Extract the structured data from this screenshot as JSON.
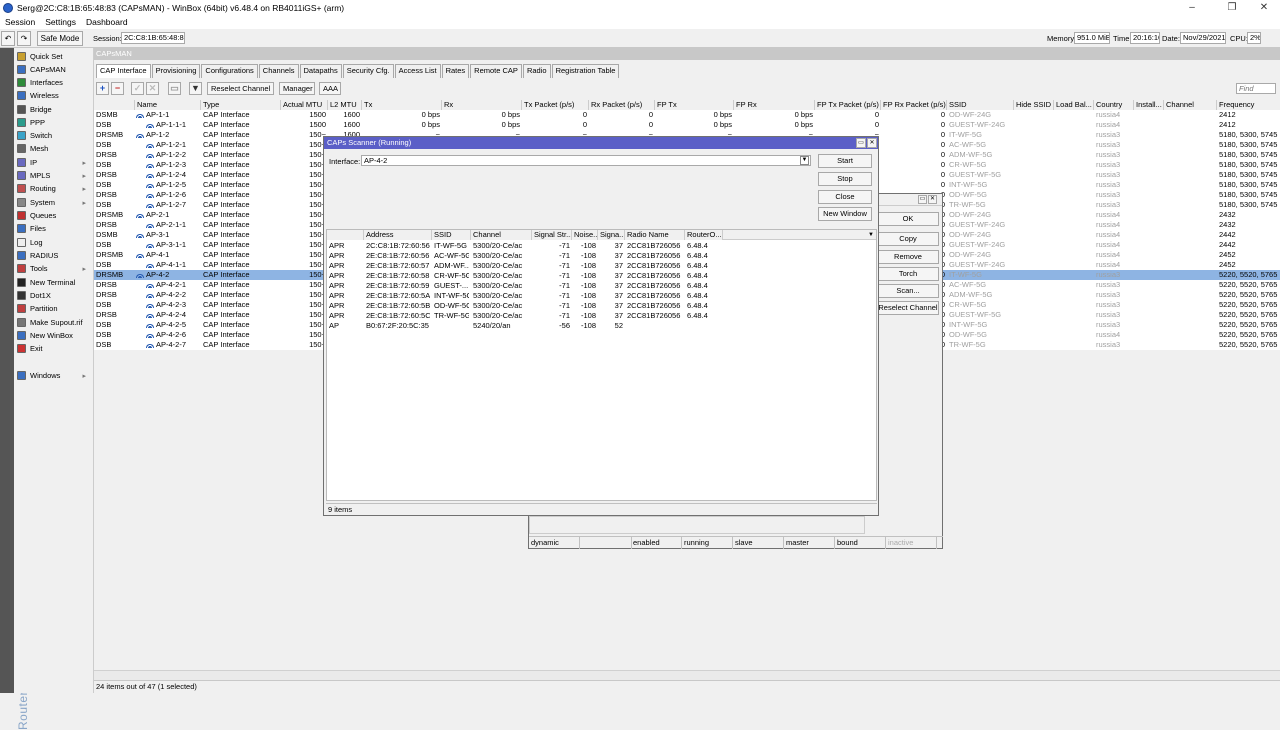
{
  "window": {
    "title": "Serg@2C:C8:1B:65:48:83 (CAPsMAN) - WinBox (64bit) v6.48.4 on RB4011iGS+ (arm)",
    "minimize": "–",
    "maximize": "❐",
    "close": "✕"
  },
  "menubar": [
    "Session",
    "Settings",
    "Dashboard"
  ],
  "toolbar": {
    "undo": "↶",
    "redo": "↷",
    "safe_mode": "Safe Mode",
    "session_label": "Session:",
    "session_value": "2C:C8:1B:65:48:83",
    "memory_label": "Memory:",
    "memory_value": "951.0 MiB",
    "time_label": "Time:",
    "time_value": "20:16:16",
    "date_label": "Date:",
    "date_value": "Nov/29/2021",
    "cpu_label": "CPU:",
    "cpu_value": "2%"
  },
  "sidebar": {
    "brand": "RouterOS WinBox",
    "items": [
      {
        "label": "Quick Set",
        "icon": "quick-set-icon",
        "color": "#c8a030"
      },
      {
        "label": "CAPsMAN",
        "icon": "capsman-icon",
        "color": "#3b6fc0"
      },
      {
        "label": "Interfaces",
        "icon": "interfaces-icon",
        "color": "#2e8b3a"
      },
      {
        "label": "Wireless",
        "icon": "wireless-icon",
        "color": "#3b6fc0"
      },
      {
        "label": "Bridge",
        "icon": "bridge-icon",
        "color": "#555555"
      },
      {
        "label": "PPP",
        "icon": "ppp-icon",
        "color": "#2b9c8c"
      },
      {
        "label": "Switch",
        "icon": "switch-icon",
        "color": "#3aa3c9"
      },
      {
        "label": "Mesh",
        "icon": "mesh-icon",
        "color": "#666666"
      },
      {
        "label": "IP",
        "icon": "ip-icon",
        "color": "#6a6ac0",
        "arrow": "▸"
      },
      {
        "label": "MPLS",
        "icon": "mpls-icon",
        "color": "#6a6ac0",
        "arrow": "▸"
      },
      {
        "label": "Routing",
        "icon": "routing-icon",
        "color": "#c05050",
        "arrow": "▸"
      },
      {
        "label": "System",
        "icon": "system-icon",
        "color": "#888888",
        "arrow": "▸"
      },
      {
        "label": "Queues",
        "icon": "queues-icon",
        "color": "#c03030"
      },
      {
        "label": "Files",
        "icon": "files-icon",
        "color": "#3b6fc0"
      },
      {
        "label": "Log",
        "icon": "log-icon",
        "color": "#eeeeee"
      },
      {
        "label": "RADIUS",
        "icon": "radius-icon",
        "color": "#3b6fc0"
      },
      {
        "label": "Tools",
        "icon": "tools-icon",
        "color": "#c04040",
        "arrow": "▸"
      },
      {
        "label": "New Terminal",
        "icon": "terminal-icon",
        "color": "#222222"
      },
      {
        "label": "Dot1X",
        "icon": "dot1x-icon",
        "color": "#333333"
      },
      {
        "label": "Partition",
        "icon": "partition-icon",
        "color": "#c04040"
      },
      {
        "label": "Make Supout.rif",
        "icon": "supout-icon",
        "color": "#777777"
      },
      {
        "label": "New WinBox",
        "icon": "winbox-icon",
        "color": "#3b6fc0"
      },
      {
        "label": "Exit",
        "icon": "exit-icon",
        "color": "#cc3333"
      },
      {
        "label": "Windows",
        "icon": "windows-icon",
        "color": "#3b6fc0",
        "arrow": "▸"
      }
    ]
  },
  "capsman": {
    "title": "CAPsMAN",
    "tabs": [
      "CAP Interface",
      "Provisioning",
      "Configurations",
      "Channels",
      "Datapaths",
      "Security Cfg.",
      "Access List",
      "Rates",
      "Remote CAP",
      "Radio",
      "Registration Table"
    ],
    "buttons": {
      "add": "+",
      "remove": "−",
      "enable": "✓",
      "disable": "✕",
      "comment": "▭",
      "filter": "▼",
      "reselect": "Reselect Channel",
      "manager": "Manager",
      "aaa": "AAA"
    },
    "find_placeholder": "Find",
    "columns": [
      "",
      "Name",
      "Type",
      "Actual MTU",
      "L2 MTU",
      "Tx",
      "Rx",
      "Tx Packet (p/s)",
      "Rx Packet (p/s)",
      "FP Tx",
      "FP Rx",
      "FP Tx Packet (p/s)",
      "FP Rx Packet (p/s)",
      "SSID",
      "Hide SSID",
      "Load Bal...",
      "Country",
      "Install...",
      "Channel",
      "Frequency"
    ],
    "rows": [
      {
        "flags": "DSMB",
        "name": "AP-1-1",
        "indent": 0,
        "type": "CAP Interface",
        "mtu": "1500",
        "l2": "1600",
        "tx": "0 bps",
        "rx": "0 bps",
        "txp": "0",
        "rxp": "0",
        "fptx": "0 bps",
        "fprx": "0 bps",
        "fptxp": "0",
        "fprxp": "0",
        "ssid": "OD-WF-24G",
        "country": "russia4",
        "freq": "2412"
      },
      {
        "flags": "DSB",
        "name": "AP-1-1-1",
        "indent": 1,
        "type": "CAP Interface",
        "mtu": "1500",
        "l2": "1600",
        "tx": "0 bps",
        "rx": "0 bps",
        "txp": "0",
        "rxp": "0",
        "fptx": "0 bps",
        "fprx": "0 bps",
        "fptxp": "0",
        "fprxp": "0",
        "ssid": "GUEST-WF-24G",
        "country": "russia4",
        "freq": "2412"
      },
      {
        "flags": "DRSMB",
        "name": "AP-1-2",
        "indent": 0,
        "type": "CAP Interface",
        "mtu": "150~",
        "l2": "1600",
        "tx": "~",
        "rx": "~",
        "txp": "~",
        "rxp": "~",
        "fptx": "~",
        "fprx": "~",
        "fptxp": "~",
        "fprxp": "0",
        "ssid": "IT-WF-5G",
        "country": "russia3",
        "freq": "5180, 5300, 5745"
      },
      {
        "flags": "DSB",
        "name": "AP-1-2-1",
        "indent": 1,
        "type": "CAP Interface",
        "mtu": "150~",
        "l2": "",
        "tx": "",
        "rx": "",
        "txp": "",
        "rxp": "",
        "fptx": "",
        "fprx": "",
        "fptxp": "",
        "fprxp": "0",
        "ssid": "AC-WF-5G",
        "country": "russia3",
        "freq": "5180, 5300, 5745"
      },
      {
        "flags": "DRSB",
        "name": "AP-1-2-2",
        "indent": 1,
        "type": "CAP Interface",
        "mtu": "150~",
        "l2": "",
        "tx": "",
        "rx": "",
        "txp": "",
        "rxp": "",
        "fptx": "",
        "fprx": "",
        "fptxp": "",
        "fprxp": "0",
        "ssid": "ADM-WF-5G",
        "country": "russia3",
        "freq": "5180, 5300, 5745"
      },
      {
        "flags": "DSB",
        "name": "AP-1-2-3",
        "indent": 1,
        "type": "CAP Interface",
        "mtu": "150~",
        "l2": "",
        "tx": "",
        "rx": "",
        "txp": "",
        "rxp": "",
        "fptx": "",
        "fprx": "",
        "fptxp": "",
        "fprxp": "0",
        "ssid": "CR-WF-5G",
        "country": "russia3",
        "freq": "5180, 5300, 5745"
      },
      {
        "flags": "DRSB",
        "name": "AP-1-2-4",
        "indent": 1,
        "type": "CAP Interface",
        "mtu": "150~",
        "l2": "",
        "tx": "",
        "rx": "",
        "txp": "",
        "rxp": "",
        "fptx": "",
        "fprx": "",
        "fptxp": "",
        "fprxp": "0",
        "ssid": "GUEST-WF-5G",
        "country": "russia3",
        "freq": "5180, 5300, 5745"
      },
      {
        "flags": "DSB",
        "name": "AP-1-2-5",
        "indent": 1,
        "type": "CAP Interface",
        "mtu": "150~",
        "l2": "",
        "tx": "",
        "rx": "",
        "txp": "",
        "rxp": "",
        "fptx": "",
        "fprx": "",
        "fptxp": "",
        "fprxp": "0",
        "ssid": "INT-WF-5G",
        "country": "russia3",
        "freq": "5180, 5300, 5745"
      },
      {
        "flags": "DRSB",
        "name": "AP-1-2-6",
        "indent": 1,
        "type": "CAP Interface",
        "mtu": "150~",
        "l2": "",
        "tx": "",
        "rx": "",
        "txp": "",
        "rxp": "",
        "fptx": "",
        "fprx": "",
        "fptxp": "",
        "fprxp": "0",
        "ssid": "OD-WF-5G",
        "country": "russia3",
        "freq": "5180, 5300, 5745"
      },
      {
        "flags": "DSB",
        "name": "AP-1-2-7",
        "indent": 1,
        "type": "CAP Interface",
        "mtu": "150~",
        "l2": "",
        "tx": "",
        "rx": "",
        "txp": "",
        "rxp": "",
        "fptx": "",
        "fprx": "",
        "fptxp": "",
        "fprxp": "0",
        "ssid": "TR-WF-5G",
        "country": "russia3",
        "freq": "5180, 5300, 5745"
      },
      {
        "flags": "DRSMB",
        "name": "AP-2-1",
        "indent": 0,
        "type": "CAP Interface",
        "mtu": "150~",
        "l2": "",
        "tx": "",
        "rx": "",
        "txp": "",
        "rxp": "",
        "fptx": "",
        "fprx": "",
        "fptxp": "",
        "fprxp": "0",
        "ssid": "OD-WF-24G",
        "country": "russia4",
        "freq": "2432"
      },
      {
        "flags": "DRSB",
        "name": "AP-2-1-1",
        "indent": 1,
        "type": "CAP Interface",
        "mtu": "150~",
        "l2": "",
        "tx": "",
        "rx": "",
        "txp": "",
        "rxp": "",
        "fptx": "",
        "fprx": "",
        "fptxp": "",
        "fprxp": "0",
        "ssid": "GUEST-WF-24G",
        "country": "russia4",
        "freq": "2432"
      },
      {
        "flags": "DSMB",
        "name": "AP-3-1",
        "indent": 0,
        "type": "CAP Interface",
        "mtu": "150~",
        "l2": "",
        "tx": "",
        "rx": "",
        "txp": "",
        "rxp": "",
        "fptx": "",
        "fprx": "",
        "fptxp": "",
        "fprxp": "0",
        "ssid": "OD-WF-24G",
        "country": "russia4",
        "freq": "2442"
      },
      {
        "flags": "DSB",
        "name": "AP-3-1-1",
        "indent": 1,
        "type": "CAP Interface",
        "mtu": "150~",
        "l2": "",
        "tx": "",
        "rx": "",
        "txp": "",
        "rxp": "",
        "fptx": "",
        "fprx": "",
        "fptxp": "",
        "fprxp": "0",
        "ssid": "GUEST-WF-24G",
        "country": "russia4",
        "freq": "2442"
      },
      {
        "flags": "DRSMB",
        "name": "AP-4-1",
        "indent": 0,
        "type": "CAP Interface",
        "mtu": "150~",
        "l2": "",
        "tx": "",
        "rx": "",
        "txp": "",
        "rxp": "",
        "fptx": "",
        "fprx": "",
        "fptxp": "",
        "fprxp": "0",
        "ssid": "OD-WF-24G",
        "country": "russia4",
        "freq": "2452"
      },
      {
        "flags": "DSB",
        "name": "AP-4-1-1",
        "indent": 1,
        "type": "CAP Interface",
        "mtu": "150~",
        "l2": "",
        "tx": "",
        "rx": "",
        "txp": "",
        "rxp": "",
        "fptx": "",
        "fprx": "",
        "fptxp": "",
        "fprxp": "0",
        "ssid": "GUEST-WF-24G",
        "country": "russia4",
        "freq": "2452"
      },
      {
        "flags": "DRSMB",
        "name": "AP-4-2",
        "indent": 0,
        "type": "CAP Interface",
        "mtu": "150~",
        "l2": "",
        "tx": "",
        "rx": "",
        "txp": "",
        "rxp": "",
        "fptx": "",
        "fprx": "",
        "fptxp": "",
        "fprxp": "0",
        "ssid": "IT-WF-5G",
        "country": "russia3",
        "freq": "5220, 5520, 5765",
        "selected": true
      },
      {
        "flags": "DRSB",
        "name": "AP-4-2-1",
        "indent": 1,
        "type": "CAP Interface",
        "mtu": "150~",
        "l2": "",
        "tx": "",
        "rx": "",
        "txp": "",
        "rxp": "",
        "fptx": "",
        "fprx": "",
        "fptxp": "",
        "fprxp": "0",
        "ssid": "AC-WF-5G",
        "country": "russia3",
        "freq": "5220, 5520, 5765"
      },
      {
        "flags": "DRSB",
        "name": "AP-4-2-2",
        "indent": 1,
        "type": "CAP Interface",
        "mtu": "150~",
        "l2": "",
        "tx": "",
        "rx": "",
        "txp": "",
        "rxp": "",
        "fptx": "",
        "fprx": "",
        "fptxp": "",
        "fprxp": "0",
        "ssid": "ADM-WF-5G",
        "country": "russia3",
        "freq": "5220, 5520, 5765"
      },
      {
        "flags": "DSB",
        "name": "AP-4-2-3",
        "indent": 1,
        "type": "CAP Interface",
        "mtu": "150~",
        "l2": "",
        "tx": "",
        "rx": "",
        "txp": "",
        "rxp": "",
        "fptx": "",
        "fprx": "",
        "fptxp": "",
        "fprxp": "0",
        "ssid": "CR-WF-5G",
        "country": "russia3",
        "freq": "5220, 5520, 5765"
      },
      {
        "flags": "DRSB",
        "name": "AP-4-2-4",
        "indent": 1,
        "type": "CAP Interface",
        "mtu": "150~",
        "l2": "",
        "tx": "",
        "rx": "",
        "txp": "",
        "rxp": "",
        "fptx": "",
        "fprx": "",
        "fptxp": "",
        "fprxp": "0",
        "ssid": "GUEST-WF-5G",
        "country": "russia3",
        "freq": "5220, 5520, 5765"
      },
      {
        "flags": "DSB",
        "name": "AP-4-2-5",
        "indent": 1,
        "type": "CAP Interface",
        "mtu": "150~",
        "l2": "",
        "tx": "",
        "rx": "",
        "txp": "",
        "rxp": "",
        "fptx": "",
        "fprx": "",
        "fptxp": "",
        "fprxp": "0",
        "ssid": "INT-WF-5G",
        "country": "russia3",
        "freq": "5220, 5520, 5765"
      },
      {
        "flags": "DSB",
        "name": "AP-4-2-6",
        "indent": 1,
        "type": "CAP Interface",
        "mtu": "150~",
        "l2": "",
        "tx": "",
        "rx": "",
        "txp": "",
        "rxp": "",
        "fptx": "",
        "fprx": "",
        "fptxp": "",
        "fprxp": "0",
        "ssid": "OD-WF-5G",
        "country": "russia4",
        "freq": "5220, 5520, 5765"
      },
      {
        "flags": "DSB",
        "name": "AP-4-2-7",
        "indent": 1,
        "type": "CAP Interface",
        "mtu": "150~",
        "l2": "",
        "tx": "",
        "rx": "",
        "txp": "",
        "rxp": "",
        "fptx": "",
        "fprx": "",
        "fptxp": "",
        "fprxp": "0",
        "ssid": "TR-WF-5G",
        "country": "russia3",
        "freq": "5220, 5520, 5765"
      }
    ],
    "status": "24 items out of 47 (1 selected)"
  },
  "interface_dialog": {
    "title": "",
    "buttons": [
      "OK",
      "Copy",
      "Remove",
      "Torch",
      "Scan...",
      "Reselect Channel"
    ],
    "status": [
      "dynamic",
      "",
      "enabled",
      "running",
      "slave",
      "master",
      "bound",
      "inactive"
    ]
  },
  "scanner": {
    "title": "CAPs Scanner (Running)",
    "interface_label": "Interface:",
    "interface_value": "AP-4-2",
    "buttons": {
      "start": "Start",
      "stop": "Stop",
      "close": "Close",
      "new_window": "New Window"
    },
    "columns": [
      "",
      "Address",
      "SSID",
      "Channel",
      "Signal Str...",
      "Noise...",
      "Signa...",
      "Radio Name",
      "RouterO..."
    ],
    "rows": [
      {
        "flags": "APR",
        "address": "2C:C8:1B:72:60:56",
        "ssid": "IT-WF-5G",
        "channel": "5300/20-Ce/ac",
        "signal": "-71",
        "noise": "-108",
        "snr": "37",
        "radio": "2CC81B726056",
        "ros": "6.48.4"
      },
      {
        "flags": "APR",
        "address": "2E:C8:1B:72:60:56",
        "ssid": "AC-WF-5G",
        "channel": "5300/20-Ce/ac",
        "signal": "-71",
        "noise": "-108",
        "snr": "37",
        "radio": "2CC81B726056",
        "ros": "6.48.4"
      },
      {
        "flags": "APR",
        "address": "2E:C8:1B:72:60:57",
        "ssid": "ADM-WF...",
        "channel": "5300/20-Ce/ac",
        "signal": "-71",
        "noise": "-108",
        "snr": "37",
        "radio": "2CC81B726056",
        "ros": "6.48.4"
      },
      {
        "flags": "APR",
        "address": "2E:C8:1B:72:60:58",
        "ssid": "CR-WF-5G",
        "channel": "5300/20-Ce/ac",
        "signal": "-71",
        "noise": "-108",
        "snr": "37",
        "radio": "2CC81B726056",
        "ros": "6.48.4"
      },
      {
        "flags": "APR",
        "address": "2E:C8:1B:72:60:59",
        "ssid": "GUEST-...",
        "channel": "5300/20-Ce/ac",
        "signal": "-71",
        "noise": "-108",
        "snr": "37",
        "radio": "2CC81B726056",
        "ros": "6.48.4"
      },
      {
        "flags": "APR",
        "address": "2E:C8:1B:72:60:5A",
        "ssid": "INT-WF-5G",
        "channel": "5300/20-Ce/ac",
        "signal": "-71",
        "noise": "-108",
        "snr": "37",
        "radio": "2CC81B726056",
        "ros": "6.48.4"
      },
      {
        "flags": "APR",
        "address": "2E:C8:1B:72:60:5B",
        "ssid": "OD-WF-5G",
        "channel": "5300/20-Ce/ac",
        "signal": "-71",
        "noise": "-108",
        "snr": "37",
        "radio": "2CC81B726056",
        "ros": "6.48.4"
      },
      {
        "flags": "APR",
        "address": "2E:C8:1B:72:60:5C",
        "ssid": "TR-WF-5G",
        "channel": "5300/20-Ce/ac",
        "signal": "-71",
        "noise": "-108",
        "snr": "37",
        "radio": "2CC81B726056",
        "ros": "6.48.4"
      },
      {
        "flags": "AP",
        "address": "B0:67:2F:20:5C:35",
        "ssid": "",
        "channel": "5240/20/an",
        "signal": "-56",
        "noise": "-108",
        "snr": "52",
        "radio": "",
        "ros": ""
      }
    ],
    "status": "9 items"
  },
  "colors": {
    "dialog_title": "#5b5fc7",
    "selected_row": "#8eb4e3",
    "sidebar_band": "#555555"
  }
}
